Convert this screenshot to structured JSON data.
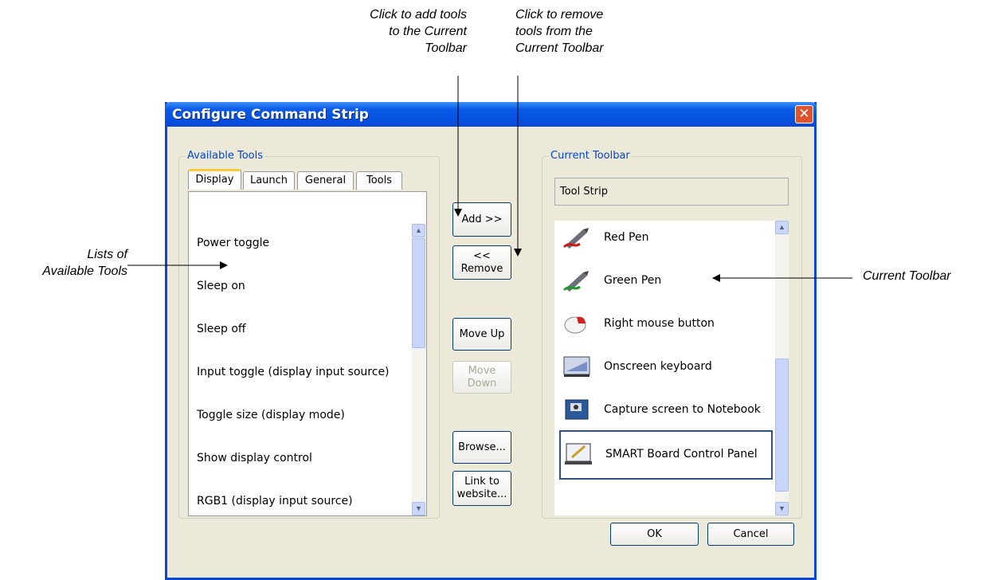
{
  "callouts": {
    "add": "Click to add tools to the Current Toolbar",
    "add_lines": [
      "Click to add tools",
      "to the Current",
      "Toolbar"
    ],
    "remove_lines": [
      "Click to remove",
      "tools from the",
      "Current Toolbar"
    ],
    "lists_lines": [
      "Lists of",
      "Available Tools"
    ],
    "current": "Current Toolbar"
  },
  "dialog": {
    "title": "Configure Command Strip",
    "close_glyph": "✕",
    "available": {
      "label": "Available Tools",
      "tabs": [
        "Display",
        "Launch",
        "General",
        "Tools"
      ],
      "items": [
        "Power toggle",
        "Sleep on",
        "Sleep off",
        "Input toggle (display input source)",
        "Toggle size (display mode)",
        "Show display control",
        "RGB1 (display input source)"
      ]
    },
    "buttons": {
      "add": "Add >>",
      "remove": "<< Remove",
      "move_up": "Move Up",
      "move_down": "Move Down",
      "browse": "Browse...",
      "link_line1": "Link to",
      "link_line2": "website..."
    },
    "current": {
      "label": "Current Toolbar",
      "name_value": "Tool Strip",
      "items": [
        {
          "label": "Red Pen",
          "icon": "red-pen-icon"
        },
        {
          "label": "Green Pen",
          "icon": "green-pen-icon"
        },
        {
          "label": "Right mouse button",
          "icon": "mouse-icon"
        },
        {
          "label": "Onscreen keyboard",
          "icon": "keyboard-icon"
        },
        {
          "label": "Capture screen to Notebook",
          "icon": "camera-icon"
        },
        {
          "label": "SMART Board Control Panel",
          "icon": "control-panel-icon"
        }
      ]
    },
    "ok": "OK",
    "cancel": "Cancel"
  },
  "colors": {
    "title_bar": "#0a5be8",
    "group_label": "#0046d5",
    "dialog_bg": "#ece9d8"
  }
}
